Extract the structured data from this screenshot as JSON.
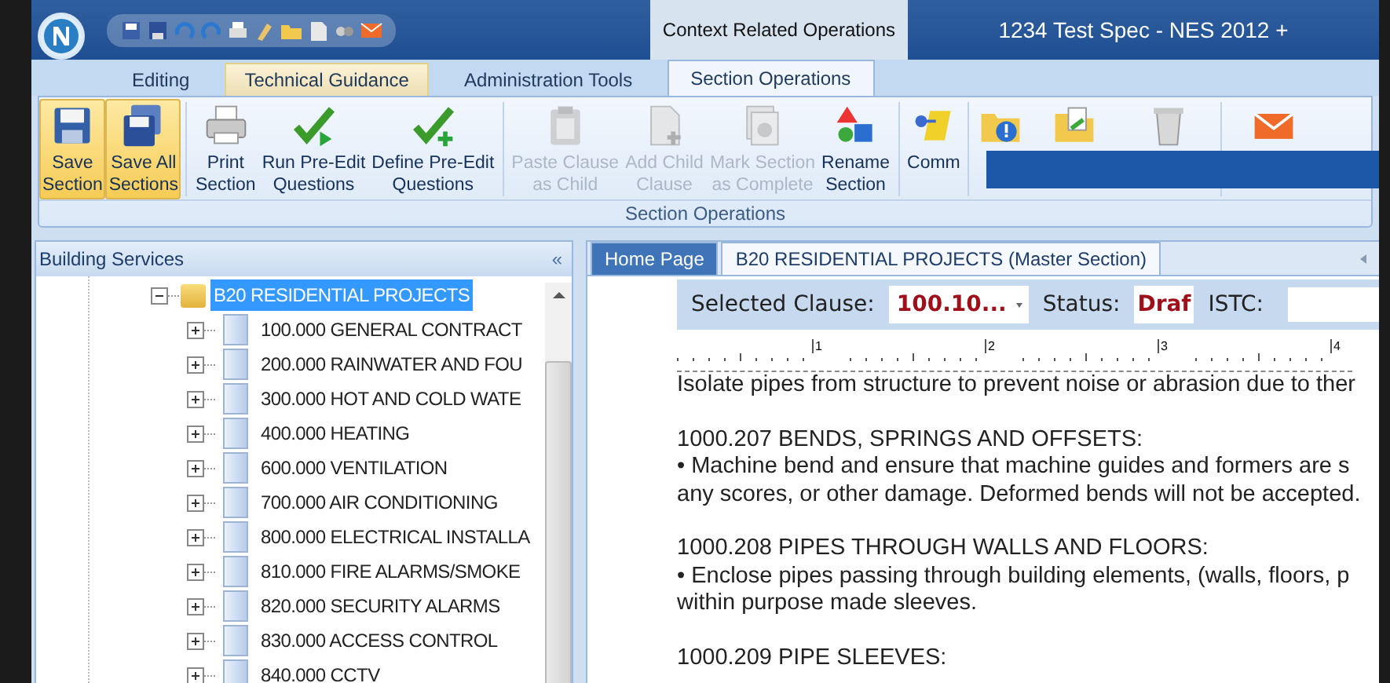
{
  "window": {
    "title": "1234 Test Spec - NES 2012 +",
    "context_tab": "Context Related Operations"
  },
  "ribbon_tabs": [
    {
      "label": "Editing",
      "selected": false
    },
    {
      "label": "Technical Guidance",
      "selected": false,
      "highlighted": true
    },
    {
      "label": "Administration Tools",
      "selected": false
    },
    {
      "label": "Section Operations",
      "selected": true
    }
  ],
  "ribbon_buttons": [
    {
      "label": "Save\nSection",
      "highlighted": true,
      "disabled": false
    },
    {
      "label": "Save All\nSections",
      "highlighted": true,
      "disabled": false
    },
    {
      "label": "Print\nSection",
      "highlighted": false,
      "disabled": false
    },
    {
      "label": "Run Pre-Edit\nQuestions",
      "highlighted": false,
      "disabled": false
    },
    {
      "label": "Define Pre-Edit\nQuestions",
      "highlighted": false,
      "disabled": false
    },
    {
      "label": "Paste Clause\nas Child",
      "highlighted": false,
      "disabled": true
    },
    {
      "label": "Add Child\nClause",
      "highlighted": false,
      "disabled": true
    },
    {
      "label": "Mark Section\nas Complete",
      "highlighted": false,
      "disabled": true
    },
    {
      "label": "Rename\nSection",
      "highlighted": false,
      "disabled": false
    },
    {
      "label": "Comm",
      "highlighted": false,
      "disabled": false
    },
    {
      "highlighted": false,
      "disabled": false
    },
    {
      "highlighted": false,
      "disabled": false
    },
    {
      "highlighted": false,
      "disabled": false
    },
    {
      "highlighted": false,
      "disabled": false
    }
  ],
  "ribbon_group": "Section Operations",
  "sidebar": {
    "title": "Building Services",
    "collapse": "«",
    "tree": [
      {
        "label": "B20 RESIDENTIAL PROJECTS",
        "selected": true,
        "expanded": true,
        "children": [
          {
            "label": "100.000 GENERAL CONTRACT",
            "selected": false,
            "expanded": false
          },
          {
            "label": "200.000 RAINWATER AND FOU",
            "selected": false,
            "expanded": false
          },
          {
            "label": "300.000 HOT AND COLD WATE",
            "selected": false,
            "expanded": false
          },
          {
            "label": "400.000 HEATING",
            "selected": false,
            "expanded": false
          },
          {
            "label": "600.000 VENTILATION",
            "selected": false,
            "expanded": false
          },
          {
            "label": "700.000 AIR CONDITIONING",
            "selected": false,
            "expanded": false
          },
          {
            "label": "800.000 ELECTRICAL INSTALLA",
            "selected": false,
            "expanded": false
          },
          {
            "label": "810.000 FIRE ALARMS/SMOKE",
            "selected": false,
            "expanded": false
          },
          {
            "label": "820.000 SECURITY ALARMS",
            "selected": false,
            "expanded": false
          },
          {
            "label": "830.000 ACCESS CONTROL",
            "selected": false,
            "expanded": false
          },
          {
            "label": "840.000 CCTV",
            "selected": false,
            "expanded": false
          }
        ]
      }
    ]
  },
  "doc_tabs": [
    {
      "label": "Home Page",
      "selected": false
    },
    {
      "label": "B20 RESIDENTIAL PROJECTS (Master Section)",
      "selected": true
    }
  ],
  "clause_bar": {
    "clause_label": "Selected Clause:",
    "clause_value": "100.10...",
    "status_label": "Status:",
    "status_value": "Draf",
    "istc_label": "ISTC:"
  },
  "ruler": [
    "1",
    "2",
    "3",
    "4"
  ],
  "document": [
    {
      "kind": "line",
      "text": "Isolate pipes from structure to prevent noise or abrasion due to ther"
    },
    {
      "kind": "gap"
    },
    {
      "kind": "line",
      "text": "1000.207 BENDS, SPRINGS AND OFFSETS:"
    },
    {
      "kind": "line",
      "text": "• Machine bend and ensure that machine guides and formers are s"
    },
    {
      "kind": "line",
      "text": "any scores, or other damage. Deformed bends will not be accepted."
    },
    {
      "kind": "gap"
    },
    {
      "kind": "line",
      "text": "1000.208 PIPES THROUGH WALLS AND FLOORS:"
    },
    {
      "kind": "line",
      "text": "• Enclose pipes passing through building elements, (walls, floors, p"
    },
    {
      "kind": "line",
      "text": "within purpose made sleeves."
    },
    {
      "kind": "gap"
    },
    {
      "kind": "line",
      "text": "1000.209 PIPE SLEEVES:"
    }
  ]
}
